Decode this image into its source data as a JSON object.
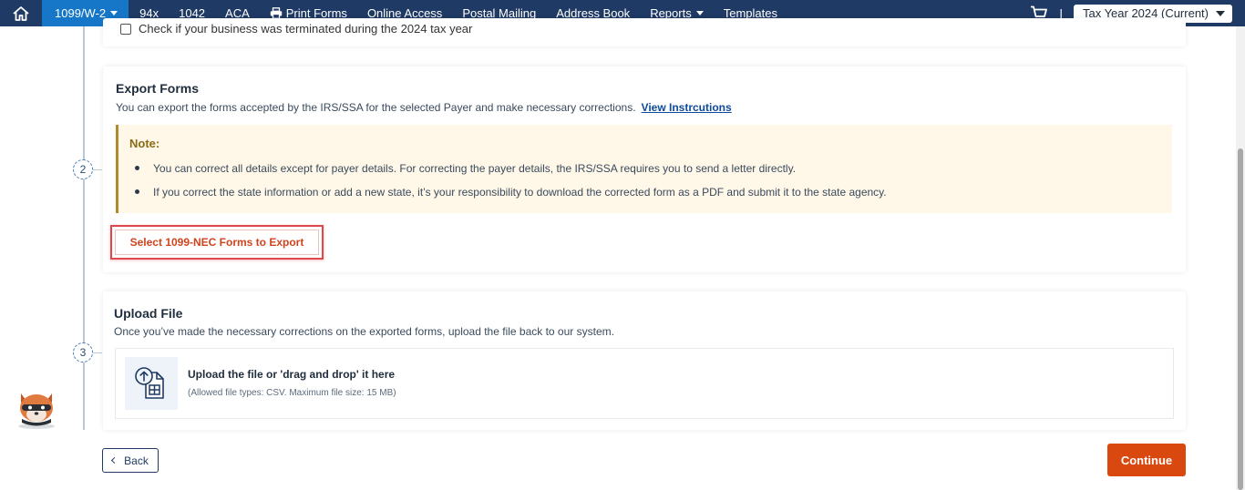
{
  "nav": {
    "active_item": "1099/W-2",
    "items": [
      "94x",
      "1042",
      "ACA",
      "Print Forms",
      "Online Access",
      "Postal Mailing",
      "Address Book",
      "Reports",
      "Templates"
    ],
    "separator": "|",
    "tax_year": "Tax Year 2024 (Current)"
  },
  "top_card": {
    "checkbox_label": "Check if your business was terminated during the 2024 tax year"
  },
  "steps": [
    "2",
    "3"
  ],
  "export": {
    "title": "Export Forms",
    "description": "You can export the forms accepted by the IRS/SSA for the selected Payer and make necessary corrections.",
    "link": "View Instrcutions",
    "note_title": "Note:",
    "notes": [
      "You can correct all details except for payer details. For correcting the payer details, the IRS/SSA requires you to send a letter directly.",
      "If you correct the state information or add a new state, it’s your responsibility to download the corrected form as a PDF and submit it to the state agency."
    ],
    "button": "Select 1099-NEC Forms to Export"
  },
  "upload": {
    "title": "Upload File",
    "description": "Once you’ve made the necessary corrections on the exported forms, upload the file back to our system.",
    "drop_title": "Upload the file or 'drag and drop' it here",
    "drop_sub": "(Allowed file types: CSV. Maximum file size: 15 MB)"
  },
  "footer": {
    "back": "Back",
    "continue": "Continue"
  },
  "colors": {
    "nav_bg": "#1f3a64",
    "nav_active": "#1677c9",
    "accent": "#d9480f",
    "highlight": "#e0474c"
  },
  "icons": [
    "home-icon",
    "printer-icon",
    "cart-icon",
    "chevron-down-icon",
    "upload-file-icon",
    "chevron-left-icon",
    "mascot-icon"
  ]
}
